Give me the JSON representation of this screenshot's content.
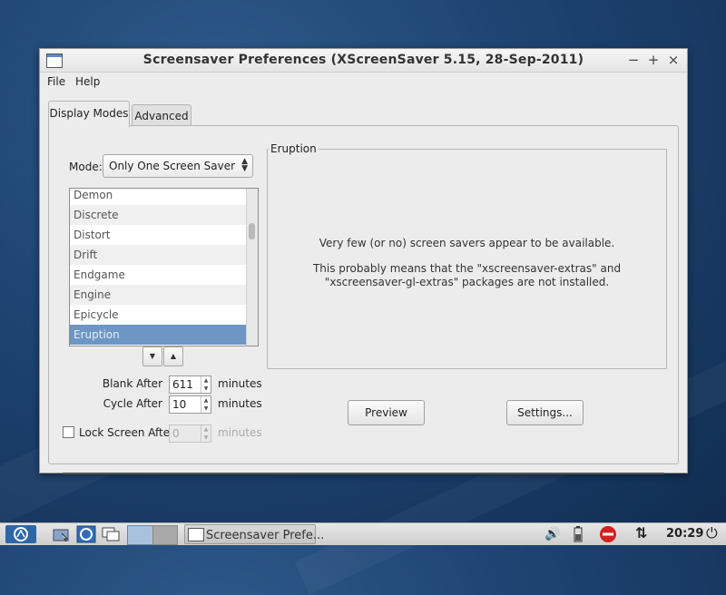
{
  "window": {
    "title": "Screensaver Preferences  (XScreenSaver 5.15, 28-Sep-2011)",
    "controls": {
      "minimize": "−",
      "maximize": "+",
      "close": "×"
    }
  },
  "menubar": {
    "file": "File",
    "help": "Help"
  },
  "tabs": [
    {
      "label": "Display Modes",
      "active": true
    },
    {
      "label": "Advanced",
      "active": false
    }
  ],
  "mode": {
    "label": "Mode:",
    "selected": "Only One Screen Saver"
  },
  "savers_list": {
    "items": [
      "Demon",
      "Discrete",
      "Distort",
      "Drift",
      "Endgame",
      "Engine",
      "Epicycle",
      "Eruption"
    ],
    "selected": "Eruption"
  },
  "settings": {
    "blank_after_label": "Blank After",
    "blank_after_value": "611",
    "cycle_after_label": "Cycle After",
    "cycle_after_value": "10",
    "lock_label": "Lock Screen After",
    "lock_value": "0",
    "lock_checked": false,
    "unit": "minutes"
  },
  "preview_group": {
    "label": "Eruption",
    "message_1": "Very few (or no) screen savers appear to be available.",
    "message_2": "This probably means that the \"xscreensaver-extras\" and",
    "message_3": "\"xscreensaver-gl-extras\" packages are not installed."
  },
  "buttons": {
    "preview": "Preview",
    "settings": "Settings..."
  },
  "taskbar": {
    "task_label": "Screensaver Prefe...",
    "clock": "20:29"
  },
  "colors": {
    "desktop": "#1f4574",
    "selection": "#6d96c4",
    "window_bg": "#ececec"
  }
}
